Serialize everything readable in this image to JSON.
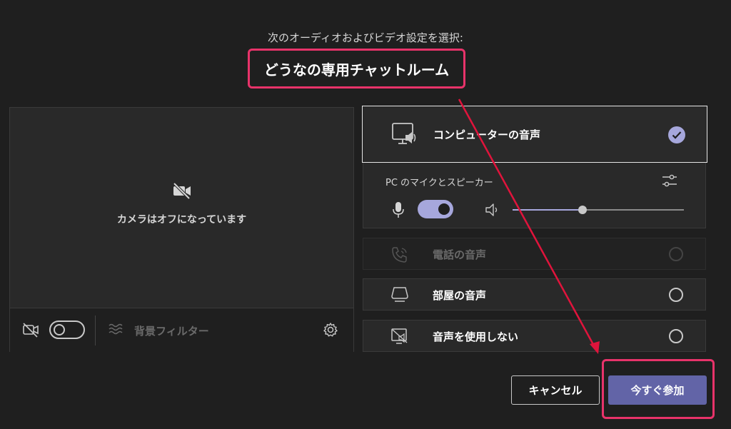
{
  "header": {
    "subtitle": "次のオーディオおよびビデオ設定を選択:",
    "meeting_title": "どうなの専用チャットルーム"
  },
  "preview": {
    "camera_off_text": "カメラはオフになっています",
    "background_filter_label": "背景フィルター",
    "camera_toggle": "off"
  },
  "audio": {
    "computer_audio": {
      "label": "コンピューターの音声",
      "selected": true
    },
    "pc_devices_label": "PC のマイクとスピーカー",
    "mic_toggle": "on",
    "volume_level": 0.41,
    "phone_audio": {
      "label": "電話の音声",
      "enabled": false
    },
    "room_audio": {
      "label": "部屋の音声"
    },
    "no_audio": {
      "label": "音声を使用しない"
    }
  },
  "buttons": {
    "cancel": "キャンセル",
    "join_now": "今すぐ参加"
  },
  "colors": {
    "background": "#1f1f1f",
    "panel": "#292929",
    "accent": "#6264a7",
    "accent_light": "#a6a7dc",
    "highlight": "#e8336a"
  }
}
